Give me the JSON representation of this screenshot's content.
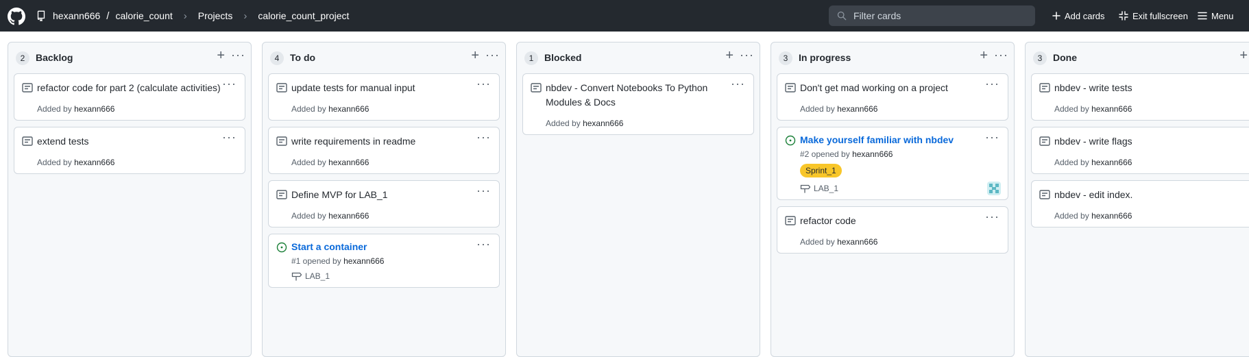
{
  "header": {
    "owner": "hexann666",
    "separator": "/",
    "repo": "calorie_count",
    "projects": "Projects",
    "project_name": "calorie_count_project",
    "filter_placeholder": "Filter cards",
    "add_cards": "Add cards",
    "exit_fullscreen": "Exit fullscreen",
    "menu": "Menu"
  },
  "columns": [
    {
      "count": "2",
      "title": "Backlog",
      "cards": [
        {
          "type": "note",
          "title": "refactor code for part 2 (calculate activities)",
          "added_by": "Added by",
          "user": "hexann666"
        },
        {
          "type": "note",
          "title": "extend tests",
          "added_by": "Added by",
          "user": "hexann666"
        }
      ]
    },
    {
      "count": "4",
      "title": "To do",
      "cards": [
        {
          "type": "note",
          "title": "update tests for manual input",
          "added_by": "Added by",
          "user": "hexann666"
        },
        {
          "type": "note",
          "title": "write requirements in readme",
          "added_by": "Added by",
          "user": "hexann666"
        },
        {
          "type": "note",
          "title": "Define MVP for LAB_1",
          "added_by": "Added by",
          "user": "hexann666"
        },
        {
          "type": "issue",
          "title": "Start a container",
          "opened": "#1 opened by",
          "user": "hexann666",
          "milestone": "LAB_1"
        }
      ]
    },
    {
      "count": "1",
      "title": "Blocked",
      "cards": [
        {
          "type": "note",
          "title": "nbdev - Convert Notebooks To Python Modules & Docs",
          "added_by": "Added by",
          "user": "hexann666"
        }
      ]
    },
    {
      "count": "3",
      "title": "In progress",
      "cards": [
        {
          "type": "note",
          "title": "Don't get mad working on a project",
          "added_by": "Added by",
          "user": "hexann666"
        },
        {
          "type": "issue",
          "title": "Make yourself familiar with nbdev",
          "opened": "#2 opened by",
          "user": "hexann666",
          "label": "Sprint_1",
          "milestone": "LAB_1"
        },
        {
          "type": "note",
          "title": "refactor code",
          "added_by": "Added by",
          "user": "hexann666"
        }
      ]
    },
    {
      "count": "3",
      "title": "Done",
      "cards": [
        {
          "type": "note",
          "title": "nbdev - write tests",
          "added_by": "Added by",
          "user": "hexann666"
        },
        {
          "type": "note",
          "title": "nbdev - write flags",
          "added_by": "Added by",
          "user": "hexann666"
        },
        {
          "type": "note",
          "title": "nbdev - edit index.",
          "added_by": "Added by",
          "user": "hexann666"
        }
      ]
    }
  ],
  "icons": {
    "logo": "github-logo-icon",
    "repo": "repo-icon",
    "search": "search-icon",
    "plus": "plus-icon",
    "fullscreen": "exit-fullscreen-icon",
    "menu": "hamburger-icon",
    "note": "note-icon",
    "issue": "issue-opened-icon",
    "milestone": "milestone-icon"
  },
  "colors": {
    "topbar": "#24292f",
    "link": "#0969da",
    "issue_green": "#1a7f37",
    "label_sprint": "#f8c62a"
  }
}
